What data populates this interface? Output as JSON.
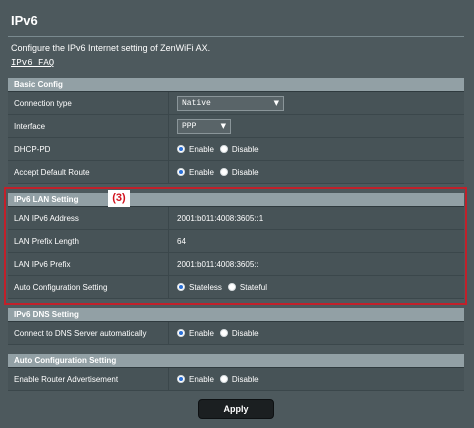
{
  "page": {
    "title": "IPv6",
    "description": "Configure the IPv6 Internet setting of ZenWiFi AX.",
    "faq_link": "IPv6 FAQ"
  },
  "basic_config": {
    "header": "Basic Config",
    "connection_type": {
      "label": "Connection type",
      "value": "Native"
    },
    "interface": {
      "label": "Interface",
      "value": "PPP"
    },
    "dhcp_pd": {
      "label": "DHCP-PD",
      "options": [
        "Enable",
        "Disable"
      ],
      "selected": "Enable"
    },
    "accept_default_route": {
      "label": "Accept Default Route",
      "options": [
        "Enable",
        "Disable"
      ],
      "selected": "Enable"
    }
  },
  "lan_setting": {
    "header": "IPv6 LAN Setting",
    "marker": "(3)",
    "lan_ipv6_address": {
      "label": "LAN IPv6 Address",
      "value": "2001:b011:4008:3605::1"
    },
    "lan_prefix_length": {
      "label": "LAN Prefix Length",
      "value": "64"
    },
    "lan_ipv6_prefix": {
      "label": "LAN IPv6 Prefix",
      "value": "2001:b011:4008:3605::"
    },
    "auto_config": {
      "label": "Auto Configuration Setting",
      "options": [
        "Stateless",
        "Stateful"
      ],
      "selected": "Stateless"
    }
  },
  "dns_setting": {
    "header": "IPv6 DNS Setting",
    "connect_dns_auto": {
      "label": "Connect to DNS Server automatically",
      "options": [
        "Enable",
        "Disable"
      ],
      "selected": "Enable"
    }
  },
  "auto_config_setting": {
    "header": "Auto Configuration Setting",
    "router_advertisement": {
      "label": "Enable Router Advertisement",
      "options": [
        "Enable",
        "Disable"
      ],
      "selected": "Enable"
    }
  },
  "actions": {
    "apply_label": "Apply"
  },
  "colors": {
    "background": "#4d595d",
    "section_header": "#92a0a5",
    "highlight_border": "#c1202a",
    "marker_text": "#d1121d",
    "apply_button": "#1b1f21"
  },
  "icons": {
    "dropdown": "chevron-down-icon",
    "radio_on": "radio-selected-icon",
    "radio_off": "radio-unselected-icon"
  }
}
